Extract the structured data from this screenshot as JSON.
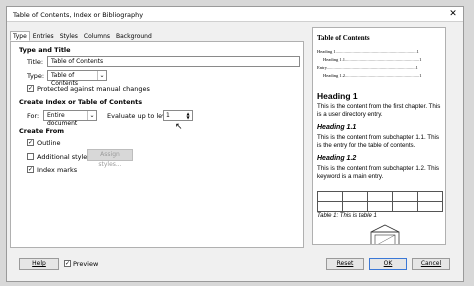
{
  "window": {
    "title": "Table of Contents, Index or Bibliography"
  },
  "tabs": [
    "Type",
    "Entries",
    "Styles",
    "Columns",
    "Background"
  ],
  "type_and_title": {
    "header": "Type and Title",
    "title_label": "Title:",
    "title_value": "Table of Contents",
    "type_label": "Type:",
    "type_value": "Table of Contents",
    "protected_label": "Protected against manual changes",
    "protected_checked": true
  },
  "create_index": {
    "header": "Create Index or Table of Contents",
    "for_label": "For:",
    "for_value": "Entire document",
    "level_label": "Evaluate up to level:",
    "level_value": "1"
  },
  "create_from": {
    "header": "Create From",
    "outline_label": "Outline",
    "outline_checked": true,
    "additional_label": "Additional styles",
    "additional_checked": false,
    "assign_styles_label": "Assign styles...",
    "index_marks_label": "Index marks",
    "index_marks_checked": true
  },
  "preview": {
    "toc_title": "Table of Contents",
    "toc_lines": [
      "Heading 1........................................................................1",
      "Heading 1.1..................................................................1",
      "Entry...............................................................................1",
      "Heading 1.2..................................................................1"
    ],
    "heading1": "Heading 1",
    "para1": "This is the content from the first chapter. This is a user directory entry.",
    "heading11": "Heading 1.1",
    "para11": "This is the content from subchapter 1.1. This is the entry for the table of contents.",
    "heading12": "Heading 1.2",
    "para12": "This is the content from subchapter 1.2. This keyword is a main entry.",
    "table_caption": "Table 1: This is table 1"
  },
  "buttons": {
    "help": "Help",
    "preview": "Preview",
    "preview_checked": true,
    "reset": "Reset",
    "ok": "OK",
    "cancel": "Cancel"
  }
}
